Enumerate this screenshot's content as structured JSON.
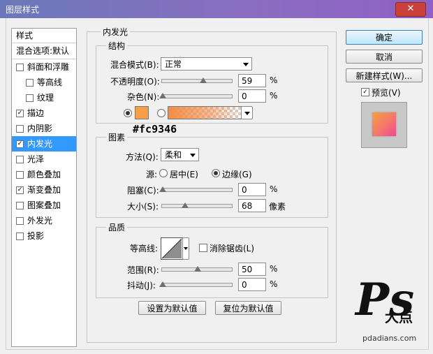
{
  "window": {
    "title": "图层样式",
    "close_glyph": "✕"
  },
  "style_list": {
    "header": "样式",
    "blend_options": "混合选项:默认",
    "items": [
      {
        "label": "斜面和浮雕",
        "checked": false,
        "indent": false
      },
      {
        "label": "等高线",
        "checked": false,
        "indent": true
      },
      {
        "label": "纹理",
        "checked": false,
        "indent": true
      },
      {
        "label": "描边",
        "checked": true,
        "indent": false
      },
      {
        "label": "内阴影",
        "checked": false,
        "indent": false
      },
      {
        "label": "内发光",
        "checked": true,
        "indent": false,
        "selected": true
      },
      {
        "label": "光泽",
        "checked": false,
        "indent": false
      },
      {
        "label": "颜色叠加",
        "checked": false,
        "indent": false
      },
      {
        "label": "渐变叠加",
        "checked": true,
        "indent": false
      },
      {
        "label": "图案叠加",
        "checked": false,
        "indent": false
      },
      {
        "label": "外发光",
        "checked": false,
        "indent": false
      },
      {
        "label": "投影",
        "checked": false,
        "indent": false
      }
    ],
    "check_glyph": "✓"
  },
  "inner_glow": {
    "title": "内发光",
    "structure": {
      "title": "结构",
      "blend_mode_label": "混合模式(B):",
      "blend_mode_value": "正常",
      "opacity_label": "不透明度(O):",
      "opacity_value": "59",
      "noise_label": "杂色(N):",
      "noise_value": "0",
      "percent": "%",
      "color_hex_annotation": "#fc9346",
      "glow_color": "#f5a048"
    },
    "elements": {
      "title": "图素",
      "technique_label": "方法(Q):",
      "technique_value": "柔和",
      "source_label": "源:",
      "center_label": "居中(E)",
      "edge_label": "边缘(G)",
      "choke_label": "阻塞(C):",
      "choke_value": "0",
      "size_label": "大小(S):",
      "size_value": "68",
      "pixels": "像素",
      "percent": "%"
    },
    "quality": {
      "title": "品质",
      "contour_label": "等高线:",
      "antialias_label": "消除锯齿(L)",
      "range_label": "范围(R):",
      "range_value": "50",
      "jitter_label": "抖动(J):",
      "jitter_value": "0",
      "percent": "%"
    },
    "make_default": "设置为默认值",
    "reset_default": "复位为默认值"
  },
  "right": {
    "ok": "确定",
    "cancel": "取消",
    "new_style": "新建样式(W)...",
    "preview_label": "预览(V)",
    "preview_checked": true
  },
  "watermark": {
    "logo": "Ps",
    "sub": "大点",
    "url": "pdadians.com"
  }
}
